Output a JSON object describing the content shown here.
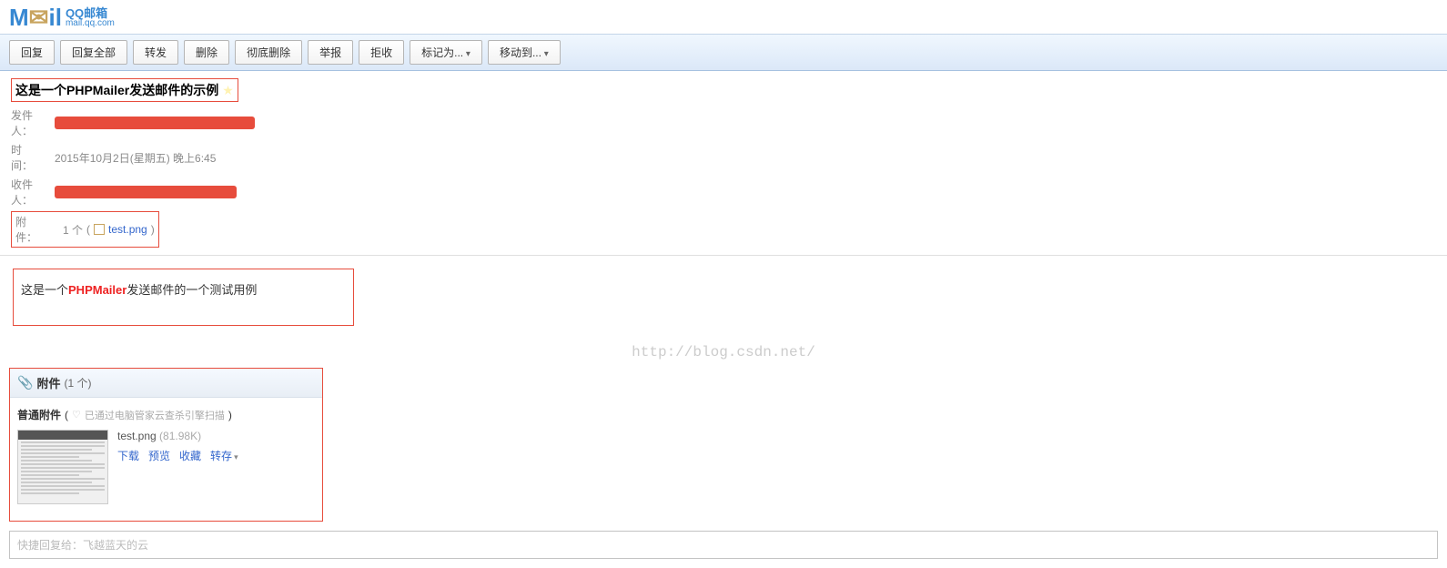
{
  "logo": {
    "brand": "Mail",
    "qq": "QQ邮箱",
    "url": "mail.qq.com"
  },
  "toolbar": {
    "reply": "回复",
    "reply_all": "回复全部",
    "forward": "转发",
    "delete": "删除",
    "delete_perm": "彻底删除",
    "report": "举报",
    "reject": "拒收",
    "mark_as": "标记为...",
    "move_to": "移动到..."
  },
  "meta": {
    "subject": "这是一个PHPMailer发送邮件的示例",
    "from_label": "发件人",
    "time_label": "时　间",
    "time_value": "2015年10月2日(星期五) 晚上6:45",
    "to_label": "收件人",
    "att_label": "附　件",
    "att_count": "1 个",
    "att_name": "test.png"
  },
  "body": {
    "prefix": "这是一个",
    "highlight": "PHPMailer",
    "suffix": "发送邮件的一个测试用例"
  },
  "watermark": "http://blog.csdn.net/",
  "attach": {
    "header": "附件",
    "count": "(1 个)",
    "sub_title": "普通附件",
    "scan": "已通过电脑管家云查杀引擎扫描",
    "file_name": "test.png",
    "file_size": "(81.98K)",
    "download": "下载",
    "preview": "预览",
    "favorite": "收藏",
    "saveas": "转存"
  },
  "quick_reply": {
    "placeholder": "快捷回复给：飞越蓝天的云"
  }
}
